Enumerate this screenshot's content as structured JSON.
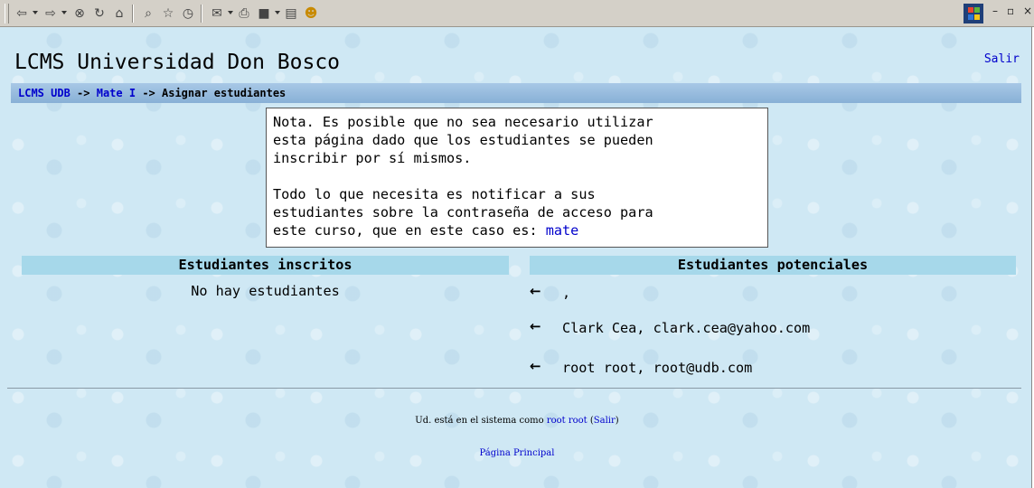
{
  "toolbar": {
    "buttons": [
      {
        "name": "back-icon",
        "glyph": "⇦"
      },
      {
        "name": "forward-icon",
        "glyph": "⇨"
      },
      {
        "name": "stop-icon",
        "glyph": "⊗"
      },
      {
        "name": "refresh-icon",
        "glyph": "↻"
      },
      {
        "name": "home-icon",
        "glyph": "⌂"
      },
      {
        "name": "search-icon",
        "glyph": "⌕"
      },
      {
        "name": "favorites-icon",
        "glyph": "☆"
      },
      {
        "name": "history-icon",
        "glyph": "◷"
      },
      {
        "name": "mail-icon",
        "glyph": "✉"
      },
      {
        "name": "print-icon",
        "glyph": "⎙"
      },
      {
        "name": "edit-icon",
        "glyph": "■"
      },
      {
        "name": "discuss-icon",
        "glyph": "▤"
      },
      {
        "name": "messenger-icon",
        "glyph": "☻"
      }
    ],
    "window_controls": [
      "–",
      "▫",
      "×"
    ]
  },
  "header": {
    "site_title": "LCMS Universidad Don Bosco",
    "logout_label": "Salir"
  },
  "breadcrumb": {
    "home": "LCMS UDB",
    "separator": "->",
    "course": "Mate I",
    "current": "Asignar estudiantes"
  },
  "note": {
    "line1": "Nota. Es posible que no sea necesario utilizar",
    "line2": "esta página dado que los estudiantes se pueden",
    "line3": "inscribir por sí mismos.",
    "line4": "Todo lo que necesita es notificar a sus",
    "line5": "estudiantes sobre la contraseña de acceso para",
    "line6_prefix": "este curso, que en este caso es: ",
    "password": "mate"
  },
  "enrolled": {
    "header": "Estudiantes inscritos",
    "empty_text": "No hay estudiantes"
  },
  "potential": {
    "header": "Estudiantes potenciales",
    "arrow": "←",
    "items": [
      {
        "text": ","
      },
      {
        "text": "Clark Cea, clark.cea@yahoo.com"
      },
      {
        "text": "root root, root@udb.com"
      }
    ]
  },
  "footer": {
    "logged_in_prefix": "Ud. está en el sistema como ",
    "user_name": "root root",
    "logout_open": " (",
    "logout_label": "Salir",
    "logout_close": ")",
    "home_link": "Página Principal"
  }
}
